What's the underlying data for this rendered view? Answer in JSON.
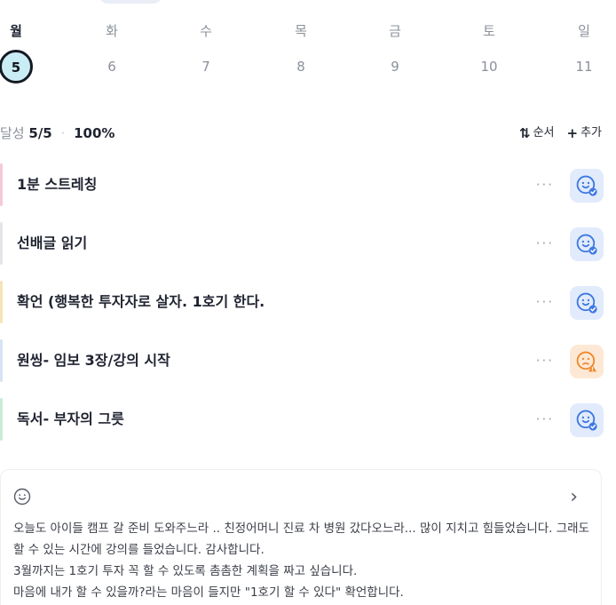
{
  "week": {
    "days": [
      {
        "name": "월",
        "date": "5",
        "active": true
      },
      {
        "name": "화",
        "date": "6",
        "active": false
      },
      {
        "name": "수",
        "date": "7",
        "active": false
      },
      {
        "name": "목",
        "date": "8",
        "active": false
      },
      {
        "name": "금",
        "date": "9",
        "active": false
      },
      {
        "name": "토",
        "date": "10",
        "active": false
      },
      {
        "name": "일",
        "date": "11",
        "active": false
      }
    ]
  },
  "summary": {
    "label": "달성",
    "count": "5/5",
    "separator": "·",
    "percent": "100%",
    "order_icon": "⇅",
    "order_label": "순서",
    "add_icon": "+",
    "add_label": "추가"
  },
  "habits": [
    {
      "title": "1분 스트레칭",
      "more": "···",
      "bar_color": "#f6c9d6",
      "mood": "blue",
      "mood_icon": "smile-check-icon"
    },
    {
      "title": "선배글 읽기",
      "more": "···",
      "bar_color": "#e3e5e8",
      "mood": "blue",
      "mood_icon": "smile-check-icon"
    },
    {
      "title": "확언 (행복한 투자자로 살자. 1호기 한다.",
      "more": "···",
      "bar_color": "#f6e3b8",
      "mood": "blue",
      "mood_icon": "smile-check-icon"
    },
    {
      "title": "원씽- 임보 3장/강의 시작",
      "more": "···",
      "bar_color": "#d6e3f3",
      "mood": "orange",
      "mood_icon": "worried-warning-icon"
    },
    {
      "title": "독서- 부자의 그릇",
      "more": "···",
      "bar_color": "#c9ecd9",
      "mood": "blue",
      "mood_icon": "smile-check-icon"
    }
  ],
  "memo": {
    "icon": "smile-outline-icon",
    "chevron": "›",
    "text": "오늘도 아이들 캠프 갈 준비 도와주느라 .. 친정어머니 진료 차 병원 갔다오느라... 많이 지치고 힘들었습니다. 그래도 할 수 있는 시간에 강의를 들었습니다. 감사합니다.\n3월까지는 1호기 투자 꼭 할 수 있도록 촘촘한 계획을 짜고 싶습니다.\n마음에 내가 할 수 있을까?라는 마음이 들지만 \"1호기 할 수 있다\" 확언합니다."
  },
  "colors": {
    "accent_blue": "#3f78e0",
    "accent_orange": "#ee8a2c",
    "today_fill": "#c9ecf5"
  }
}
